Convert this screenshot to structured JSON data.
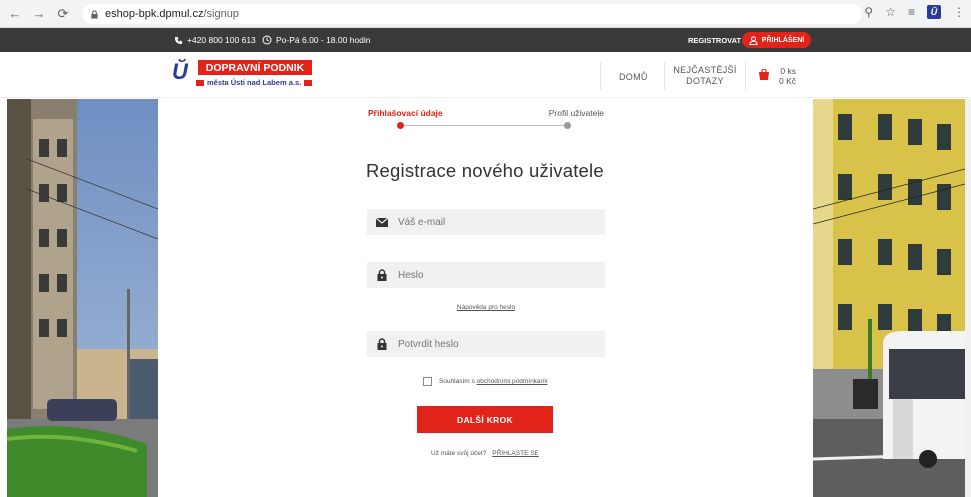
{
  "browser": {
    "url_host": "eshop-bpk.dpmul.cz",
    "url_path": "/signup",
    "back_icon": "arrow-left",
    "forward_icon": "arrow-right",
    "reload_icon": "reload"
  },
  "topbar": {
    "phone": "+420 800 100 613",
    "hours": "Po-Pá 6.00 - 18.00 hodin",
    "register": "REGISTROVAT",
    "login": "PŘIHLÁŠENÍ"
  },
  "header": {
    "logo_mark": "Ŭ",
    "logo_main": "DOPRAVNÍ PODNIK",
    "logo_sub": "města Ústí nad Labem a.s.",
    "nav_home": "DOMŮ",
    "nav_faq_line1": "NEJČASTĚJŠÍ",
    "nav_faq_line2": "DOTAZY",
    "cart_count": "0 ks",
    "cart_total": "0 Kč"
  },
  "steps": {
    "step1": "Přihlašovací údaje",
    "step2": "Profil uživatele"
  },
  "form": {
    "title": "Registrace nového uživatele",
    "email_placeholder": "Váš e-mail",
    "password_placeholder": "Heslo",
    "password_help": "Nápověda pro heslo",
    "confirm_placeholder": "Potvrdit heslo",
    "consent_text": "Souhlasím s",
    "consent_link": "obchodními podmínkami",
    "next_button": "DALŠÍ KROK",
    "have_account": "Už máte svůj účet?",
    "login_link": "PŘIHLASTE SE"
  },
  "colors": {
    "brand_red": "#e2231a",
    "brand_blue": "#2b3a9b",
    "dark_bar": "#3a3a3a"
  }
}
